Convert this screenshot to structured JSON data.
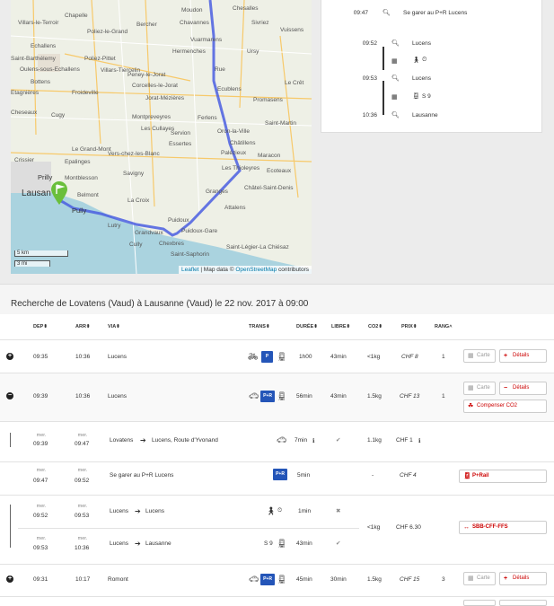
{
  "map": {
    "places": [
      "Chesalles",
      "Chapelle",
      "Villars-le-Terroir",
      "Echallens",
      "Poliez-le-Grand",
      "Bercher",
      "Saint-Barthélemy",
      "Poliez-Pittet",
      "Oulens-sous-Echallens",
      "Villars-Tiercelin",
      "Bottens",
      "Etagnières",
      "Froideville",
      "Cheseaux",
      "Cugy",
      "Crissier",
      "Le Grand-Mont",
      "Epalinges",
      "Montblesson",
      "Belmont",
      "Lutry",
      "Cully",
      "Grandvaux",
      "Chexbres",
      "Saint-Saphorin",
      "Moudon",
      "Chavannes",
      "Sivriez",
      "Vuissens",
      "Hermenches",
      "Ursy",
      "Vuarmarens",
      "Rue",
      "Ecublens",
      "Le Crêt",
      "Promasens",
      "Corcelles-le-Jorat",
      "Peney-le-Jorat",
      "Jorat-Mézières",
      "Montpreveyres",
      "Les Cullayes",
      "Servion",
      "Essertes",
      "Ferlens",
      "Oron-la-Ville",
      "Châtillens",
      "Palézieux",
      "Maracon",
      "Les Thioleyres",
      "Vers-chez-les-Blanc",
      "Savigny",
      "Ecoteaux",
      "Châtel-Saint-Denis",
      "Attalens",
      "Puidoux",
      "Puidoux-Gare",
      "Saint-Légier-La Chiésaz",
      "La Croix",
      "Granges",
      "Saint-Martin"
    ],
    "lausanne_label": "Lausan",
    "pully_label": "Pully",
    "prilly_label": "Prilly",
    "scale_km": "5 km",
    "scale_mi": "3 mi",
    "attribution_link1": "Leaflet",
    "attribution_text": "| Map data ©",
    "attribution_link2": "OpenStreetMap",
    "attribution_tail": "contributors",
    "route_color": "#4a5ee0"
  },
  "itinerary": {
    "step0": {
      "time": "09:47",
      "text": "Se garer au P+R Lucens"
    },
    "step1": {
      "time": "09:52",
      "text": "Lucens"
    },
    "step2": {
      "time": "09:53",
      "text": "Lucens",
      "line": "S 9"
    },
    "step3": {
      "time": "10:36",
      "text": "Lausanne"
    }
  },
  "results": {
    "title": "Recherche de Lovatens (Vaud) à Lausanne (Vaud) le 22 nov. 2017 à 09:00",
    "headers": {
      "dep": "DEP",
      "arr": "ARR",
      "via": "VIA",
      "trans": "TRANS",
      "duree": "DURÉE",
      "libre": "LIBRE",
      "co2": "CO2",
      "prix": "PRIX",
      "rang": "RANG"
    },
    "buttons": {
      "carte": "Carte",
      "details": "Détails",
      "compenser": "Compenser CO2"
    },
    "rows": [
      {
        "dep": "09:35",
        "arr": "10:36",
        "via": "Lucens",
        "duree": "1h00",
        "libre": "43min",
        "co2": "<1kg",
        "prix": "CHF 8",
        "rang": "1"
      },
      {
        "dep": "09:39",
        "arr": "10:36",
        "via": "Lucens",
        "duree": "56min",
        "libre": "43min",
        "co2": "1.5kg",
        "prix": "CHF 13",
        "rang": "1"
      },
      {
        "dep": "09:31",
        "arr": "10:17",
        "via": "Romont",
        "duree": "45min",
        "libre": "30min",
        "co2": "1.5kg",
        "prix": "CHF 15",
        "rang": "3"
      }
    ],
    "detail": {
      "day": "mer.",
      "seg1": {
        "dep": "09:39",
        "arr": "09:47",
        "from": "Lovatens",
        "to": "Lucens, Route d'Yvonand",
        "duree": "7min",
        "co2": "1.1kg",
        "prix": "CHF 1"
      },
      "seg2": {
        "dep": "09:47",
        "arr": "09:52",
        "text": "Se garer au P+R Lucens",
        "duree": "5min",
        "co2": "-",
        "prix": "CHF 4",
        "action": "P+Rail"
      },
      "seg3": {
        "dep": "09:52",
        "arr": "09:53",
        "from": "Lucens",
        "to": "Lucens",
        "duree": "1min"
      },
      "seg4": {
        "dep": "09:53",
        "arr": "10:36",
        "from": "Lucens",
        "to": "Lausanne",
        "line": "S 9",
        "duree": "43min"
      },
      "train_co2": "<1kg",
      "train_prix": "CHF 6.30",
      "train_action": "SBB-CFF-FFS"
    }
  }
}
